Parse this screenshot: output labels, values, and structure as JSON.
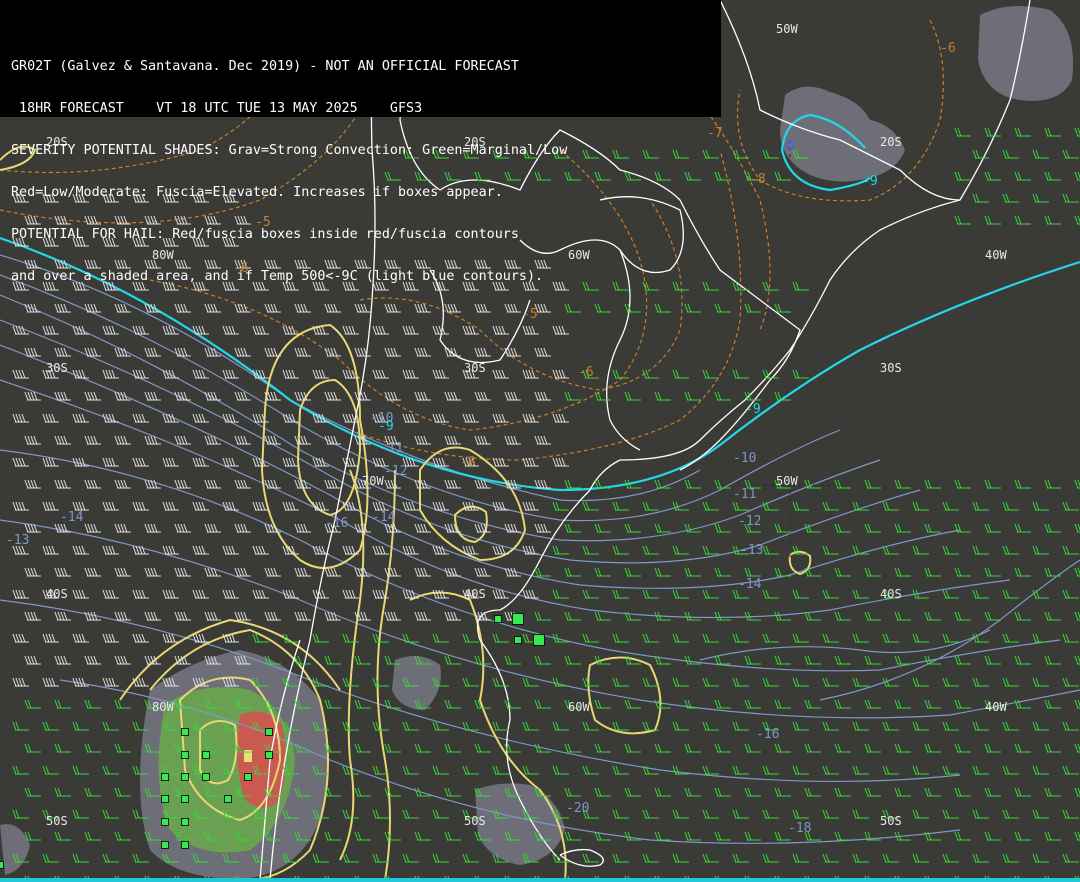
{
  "header": {
    "line1": "GR02T (Galvez & Santavana. Dec 2019) - NOT AN OFFICIAL FORECAST",
    "line2": " 18HR FORECAST    VT 18 UTC TUE 13 MAY 2025    GFS3",
    "line3": "SEVERITY POTENTIAL SHADES: Grav=Strong Convection: Green=Marginal/Low",
    "line4": "Red=Low/Moderate: Fuscia=Elevated. Increases if boxes appear.",
    "line5": "POTENTIAL FOR HAIL: Red/fuscia boxes inside red/fuscia contours",
    "line6": "and over a shaded area, and if Temp 500<-9C (light blue contours)."
  },
  "grid_labels": {
    "lat_20s_a": "20S",
    "lat_20s_b": "20S",
    "lat_20s_c": "20S",
    "lat_30s_a": "30S",
    "lat_30s_b": "30S",
    "lat_30s_c": "30S",
    "lat_40s_a": "40S",
    "lat_40s_b": "40S",
    "lat_40s_c": "40S",
    "lat_50s_a": "50S",
    "lat_50s_b": "50S",
    "lat_50s_c": "50S",
    "lon_80w_a": "80W",
    "lon_80w_b": "80W",
    "lon_70w_a": "70W",
    "lon_60w_a": "60W",
    "lon_60w_b": "60W",
    "lon_50w_a": "50W",
    "lon_50w_b": "50W",
    "lon_40w_a": "40W",
    "lon_40w_b": "40W"
  },
  "temp_labels": {
    "t_m6_ne": "-6",
    "t_m7": "-7",
    "t_m8": "-8",
    "t_m9_ne": "-9",
    "t_m5_w": "-5",
    "t_m6_w": "-6",
    "t_m5_c": "-5",
    "t_m6_c": "-6",
    "t_m8_c": "-8",
    "t_m9_c": "-9",
    "t_m9_e": "-9",
    "t_m10_c": "-10",
    "t_m10_e": "-10",
    "t_m11_c": "-11",
    "t_m11_e": "-11",
    "t_m12_c": "-12",
    "t_m12_e": "-12",
    "t_m13_w": "-13",
    "t_m13_e": "-13",
    "t_m14_w": "-14",
    "t_m14_c": "-14",
    "t_m14_e": "-14",
    "t_m16_c": "-16",
    "t_m16_e": "-16",
    "t_m18_s": "-18",
    "t_m20_s": "-20"
  },
  "colors": {
    "background": "#3a3a36",
    "header_bg": "#000000",
    "coast": "#ffffff",
    "cyan_contour": "#22d8e8",
    "light_blue_contour": "#7f97c9",
    "orange_contour": "#c8802a",
    "yellow_contour": "#e8d874",
    "wind_barb_green": "#38d838",
    "wind_barb_white": "#e0e0e0",
    "shade_gray": "#6e6e78",
    "shade_green": "#6aa052",
    "shade_red": "#c85a50",
    "box_green": "#38e850"
  }
}
